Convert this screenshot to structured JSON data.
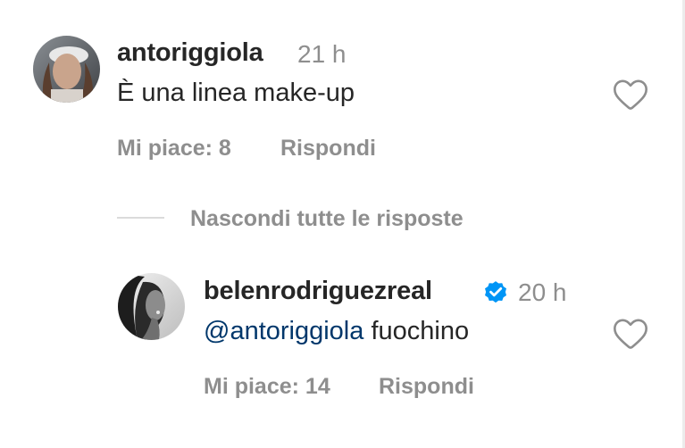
{
  "comments": [
    {
      "username": "antoriggiola",
      "time": "21 h",
      "text": "È una linea make-up",
      "likes_label": "Mi piace: 8",
      "reply_label": "Rispondi"
    }
  ],
  "thread": {
    "toggle_label": "Nascondi tutte le risposte"
  },
  "replies": [
    {
      "username": "belenrodriguezreal",
      "verified": true,
      "time": "20 h",
      "mention": "@antoriggiola",
      "text": " fuochino",
      "likes_label": "Mi piace: 14",
      "reply_label": "Rispondi"
    }
  ],
  "colors": {
    "text": "#262626",
    "secondary": "#8e8e8e",
    "mention": "#00376b",
    "verified": "#0095f6",
    "divider": "#dbdbdb"
  },
  "icons": {
    "like": "heart-outline-icon",
    "verified": "verified-badge-icon"
  }
}
